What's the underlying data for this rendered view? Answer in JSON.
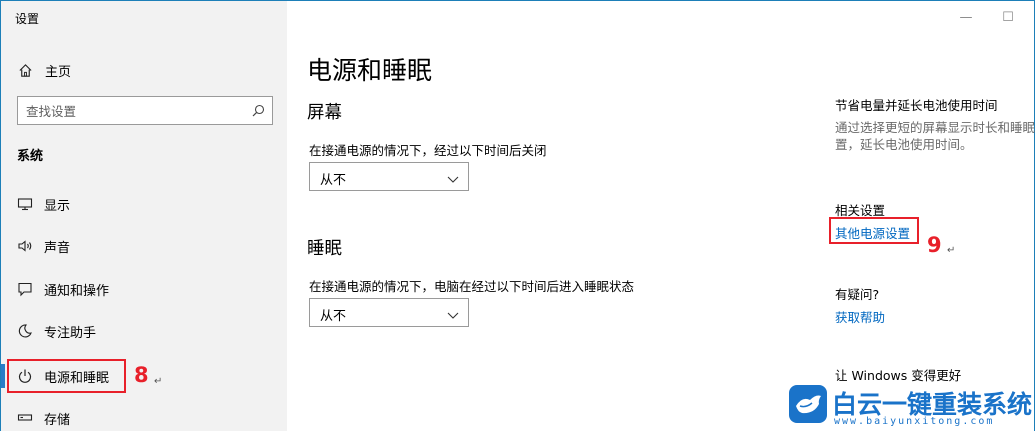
{
  "window": {
    "title": "设置"
  },
  "sidebar": {
    "home_label": "主页",
    "search_placeholder": "查找设置",
    "section_label": "系统",
    "items": [
      {
        "label": "显示",
        "icon": "monitor-icon"
      },
      {
        "label": "声音",
        "icon": "speaker-icon"
      },
      {
        "label": "通知和操作",
        "icon": "notification-icon"
      },
      {
        "label": "专注助手",
        "icon": "moon-icon"
      },
      {
        "label": "电源和睡眠",
        "icon": "power-icon",
        "active": true
      },
      {
        "label": "存储",
        "icon": "storage-icon"
      }
    ]
  },
  "annotations": {
    "step8": "8",
    "step9": "9"
  },
  "main": {
    "page_title": "电源和睡眠",
    "screen": {
      "heading": "屏幕",
      "description": "在接通电源的情况下，经过以下时间后关闭",
      "value": "从不"
    },
    "sleep": {
      "heading": "睡眠",
      "description": "在接通电源的情况下，电脑在经过以下时间后进入睡眠状态",
      "value": "从不"
    }
  },
  "right": {
    "save_title": "节省电量并延长电池使用时间",
    "save_desc_line1": "通过选择更短的屏幕显示时长和睡眠",
    "save_desc_line2": "置，延长电池使用时间。",
    "related_title": "相关设置",
    "related_link": "其他电源设置",
    "question_title": "有疑问?",
    "help_link": "获取帮助",
    "improve_title": "让 Windows 变得更好"
  },
  "watermark": {
    "text": "白云一键重装系统",
    "url": "www.baiyunxitong.com"
  },
  "colors": {
    "accent": "#2a7cc7",
    "link": "#0067c0",
    "annotation_red": "#e8202a",
    "sidebar_bg": "#f2f2f2"
  }
}
